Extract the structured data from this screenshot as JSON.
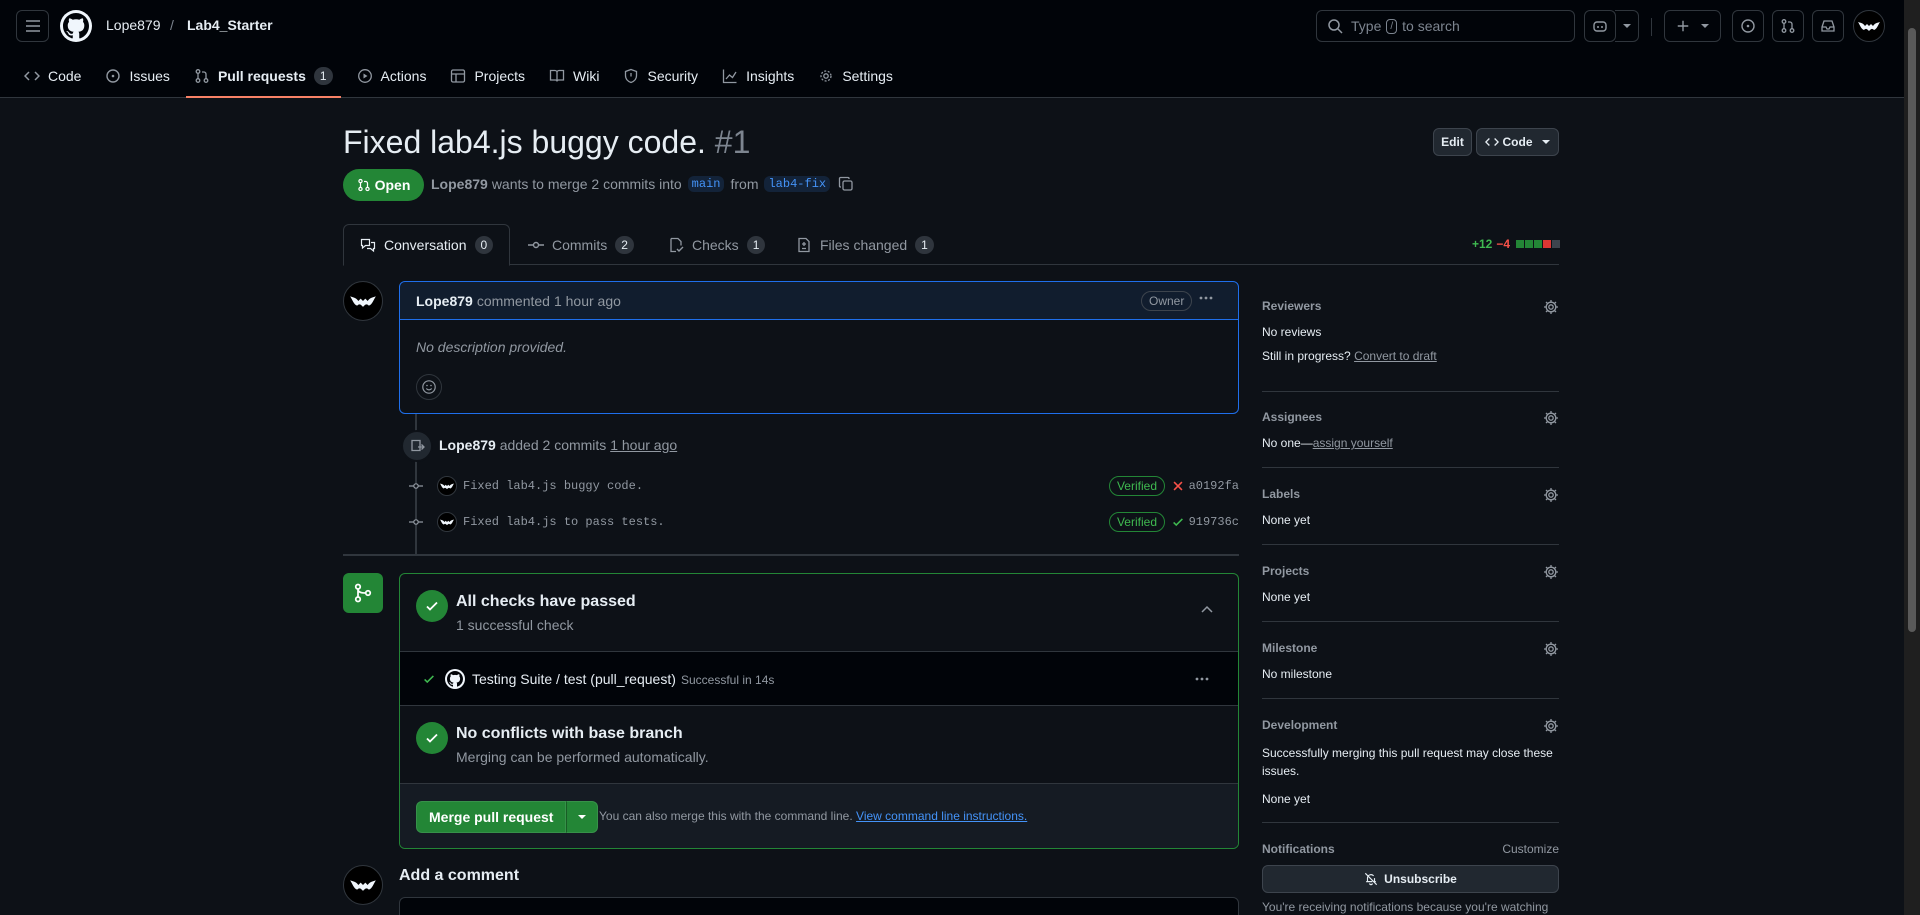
{
  "header": {
    "owner": "Lope879",
    "separator": "/",
    "repo": "Lab4_Starter",
    "search_pre": "Type",
    "search_key": "/",
    "search_post": "to search"
  },
  "repo_nav": [
    {
      "label": "Code",
      "icon": "code-icon"
    },
    {
      "label": "Issues",
      "icon": "issue-icon"
    },
    {
      "label": "Pull requests",
      "icon": "pull-request-icon",
      "count": "1",
      "active": true
    },
    {
      "label": "Actions",
      "icon": "play-icon"
    },
    {
      "label": "Projects",
      "icon": "table-icon"
    },
    {
      "label": "Wiki",
      "icon": "book-icon"
    },
    {
      "label": "Security",
      "icon": "shield-icon"
    },
    {
      "label": "Insights",
      "icon": "graph-icon"
    },
    {
      "label": "Settings",
      "icon": "gear-icon"
    }
  ],
  "pr": {
    "title": "Fixed lab4.js buggy code.",
    "number": "#1",
    "edit_label": "Edit",
    "code_label": "Code",
    "state": "Open",
    "author": "Lope879",
    "meta_text": "wants to merge 2 commits into",
    "base": "main",
    "from_text": "from",
    "head": "lab4-fix"
  },
  "pr_tabs": {
    "conversation": {
      "label": "Conversation",
      "count": "0"
    },
    "commits": {
      "label": "Commits",
      "count": "2"
    },
    "checks": {
      "label": "Checks",
      "count": "1"
    },
    "files": {
      "label": "Files changed",
      "count": "1"
    }
  },
  "diffstat": {
    "additions": "+12",
    "deletions": "−4"
  },
  "comment": {
    "author": "Lope879",
    "action": "commented",
    "time": "1 hour ago",
    "badge": "Owner",
    "body": "No description provided."
  },
  "commit_event": {
    "author": "Lope879",
    "action": "added 2 commits",
    "time": "1 hour ago",
    "commits": [
      {
        "message": "Fixed lab4.js buggy code.",
        "verified": "Verified",
        "status": "failure",
        "sha": "a0192fa"
      },
      {
        "message": "Fixed lab4.js to pass tests.",
        "verified": "Verified",
        "status": "success",
        "sha": "919736c"
      }
    ]
  },
  "merge": {
    "checks_title": "All checks have passed",
    "checks_sub": "1 successful check",
    "check_name": "Testing Suite / test (pull_request)",
    "check_status": "Successful in 14s",
    "conflicts_title": "No conflicts with base branch",
    "conflicts_sub": "Merging can be performed automatically.",
    "merge_label": "Merge pull request",
    "note": "You can also merge this with the command line.",
    "note_link": "View command line instructions."
  },
  "add_comment": "Add a comment",
  "sidebar": {
    "reviewers": {
      "heading": "Reviewers",
      "value": "No reviews",
      "progress": "Still in progress?",
      "draft_link": "Convert to draft"
    },
    "assignees": {
      "heading": "Assignees",
      "value": "No one—",
      "link": "assign yourself"
    },
    "labels": {
      "heading": "Labels",
      "value": "None yet"
    },
    "projects": {
      "heading": "Projects",
      "value": "None yet"
    },
    "milestone": {
      "heading": "Milestone",
      "value": "No milestone"
    },
    "development": {
      "heading": "Development",
      "text": "Successfully merging this pull request may close these issues.",
      "value": "None yet"
    },
    "notifications": {
      "heading": "Notifications",
      "customize": "Customize",
      "unsubscribe": "Unsubscribe",
      "footer": "You're receiving notifications because you're watching"
    }
  },
  "colors": {
    "accent": "#238636",
    "link": "#4493f8",
    "danger": "#f85149",
    "tab_underline": "#f78166"
  }
}
